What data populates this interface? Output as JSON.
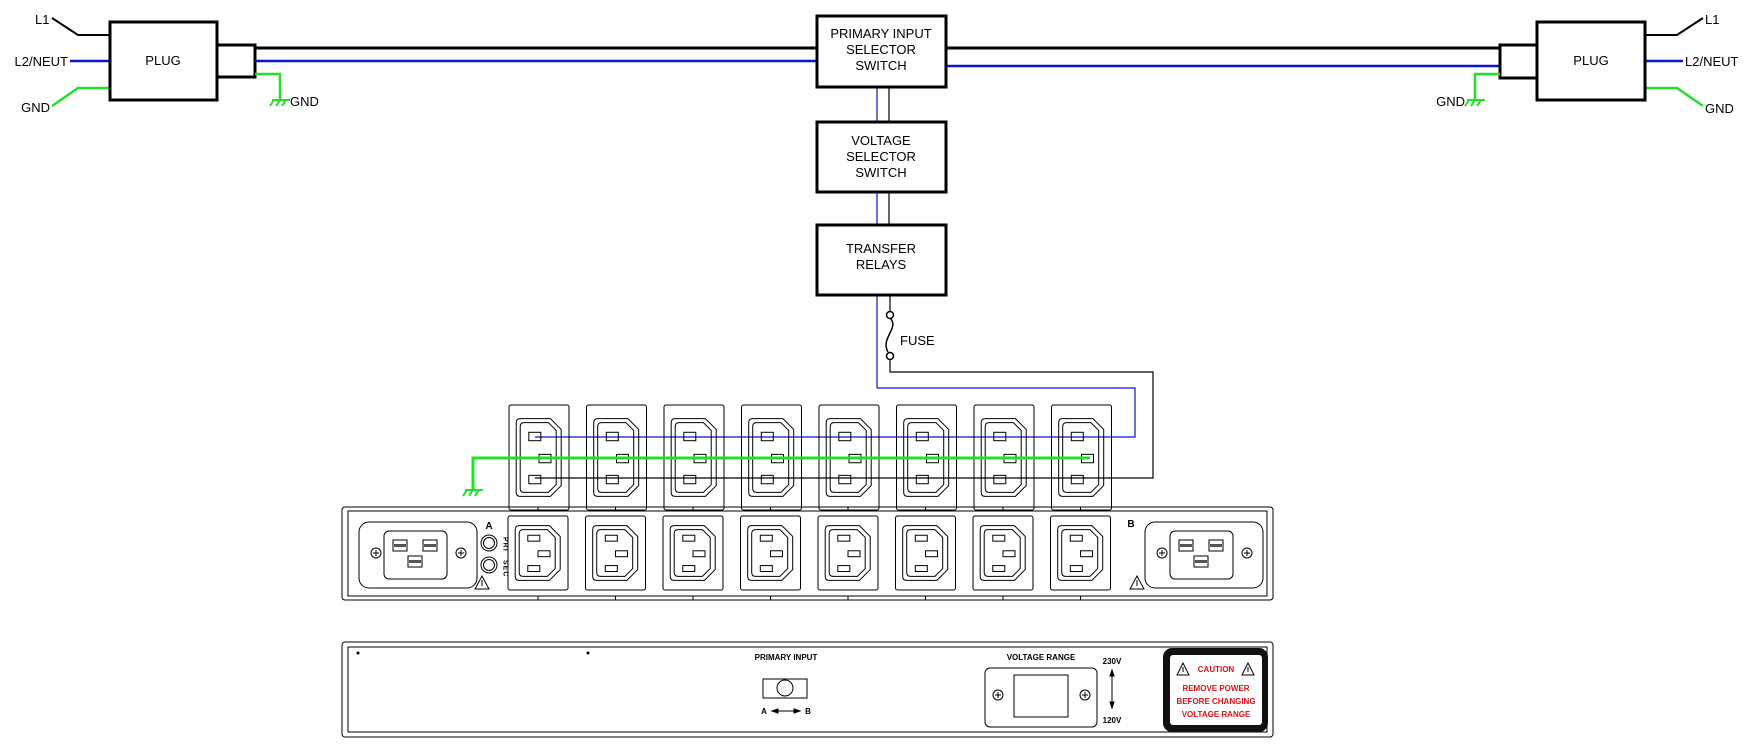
{
  "colors": {
    "line": "#000000",
    "neutral": "#0a14c8",
    "ground": "#22e02a",
    "caution": "#e0101a"
  },
  "left_plug": {
    "label": "PLUG",
    "l1": "L1",
    "l2": "L2/NEUT",
    "gnd_in": "GND",
    "gnd_out": "GND"
  },
  "right_plug": {
    "label": "PLUG",
    "l1": "L1",
    "l2": "L2/NEUT",
    "gnd_in": "GND",
    "gnd_out": "GND"
  },
  "blocks": {
    "primary": [
      "PRIMARY INPUT",
      "SELECTOR",
      "SWITCH"
    ],
    "voltage": [
      "VOLTAGE",
      "SELECTOR",
      "SWITCH"
    ],
    "transfer": [
      "TRANSFER",
      "RELAYS"
    ]
  },
  "fuse": "FUSE",
  "outlet_count": 8,
  "front_panel": {
    "input_a": "A",
    "input_b": "B",
    "led_pri": "PRI",
    "led_sec": "SEC"
  },
  "rear_panel": {
    "primary_input": "PRIMARY INPUT",
    "switch_a": "A",
    "switch_b": "B",
    "voltage_range": "VOLTAGE RANGE",
    "v_high": "230V",
    "v_low": "120V",
    "caution": "CAUTION",
    "caution_lines": [
      "REMOVE POWER",
      "BEFORE CHANGING",
      "VOLTAGE RANGE"
    ]
  }
}
